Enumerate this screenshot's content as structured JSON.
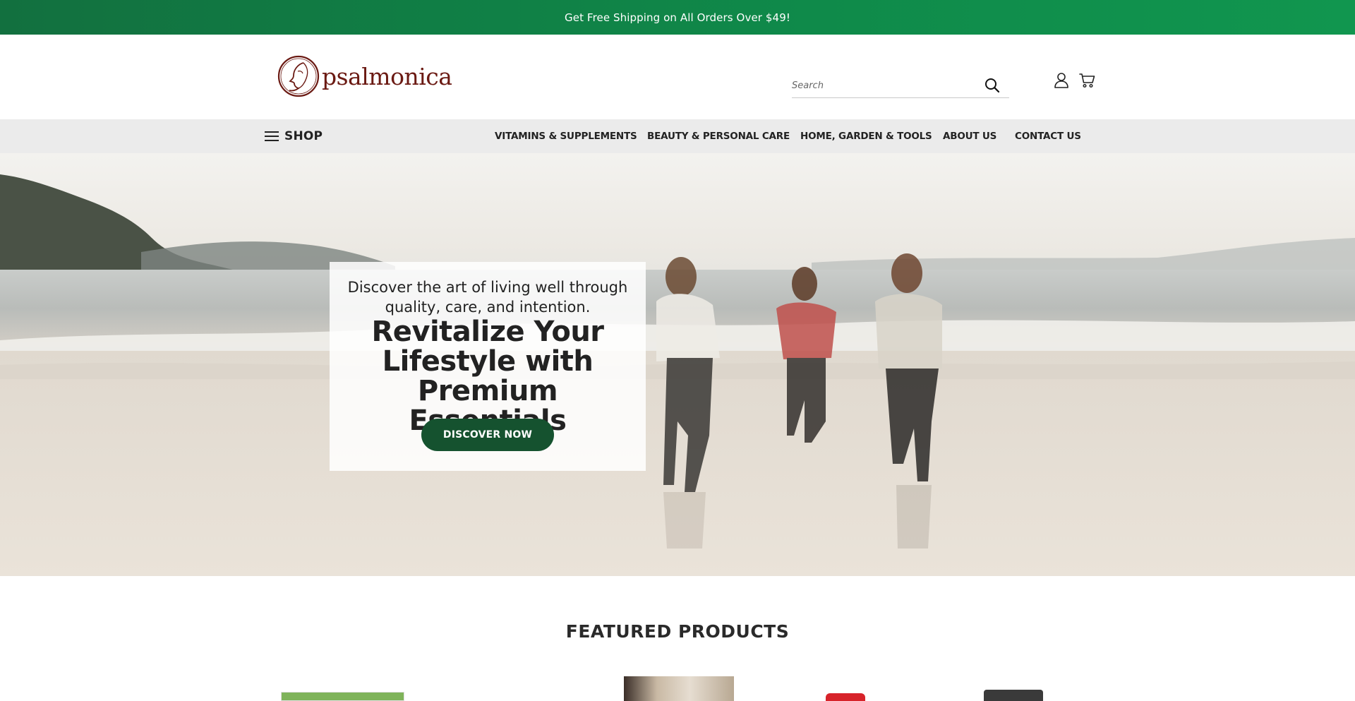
{
  "announcement": {
    "text": "Get Free Shipping on All Orders Over $49!"
  },
  "header": {
    "logo_text": "psalmonica",
    "search": {
      "placeholder": "Search",
      "value": ""
    }
  },
  "nav": {
    "shop_label": "SHOP",
    "links": [
      "VITAMINS & SUPPLEMENTS",
      "BEAUTY & PERSONAL CARE",
      "HOME, GARDEN & TOOLS",
      "ABOUT US",
      "CONTACT US"
    ]
  },
  "hero": {
    "subtitle": "Discover the art of living well through quality, care, and intention.",
    "title": "Revitalize Your Lifestyle with Premium Essentials",
    "cta_label": "DISCOVER NOW"
  },
  "featured": {
    "title": "FEATURED PRODUCTS"
  },
  "colors": {
    "announcement_bg": "#0f8a4a",
    "brand": "#6b1a13",
    "cta_bg": "#15522f",
    "nav_bg": "#ebebeb"
  },
  "icons": [
    "search-icon",
    "user-icon",
    "cart-icon",
    "hamburger-icon",
    "logo-mark"
  ]
}
